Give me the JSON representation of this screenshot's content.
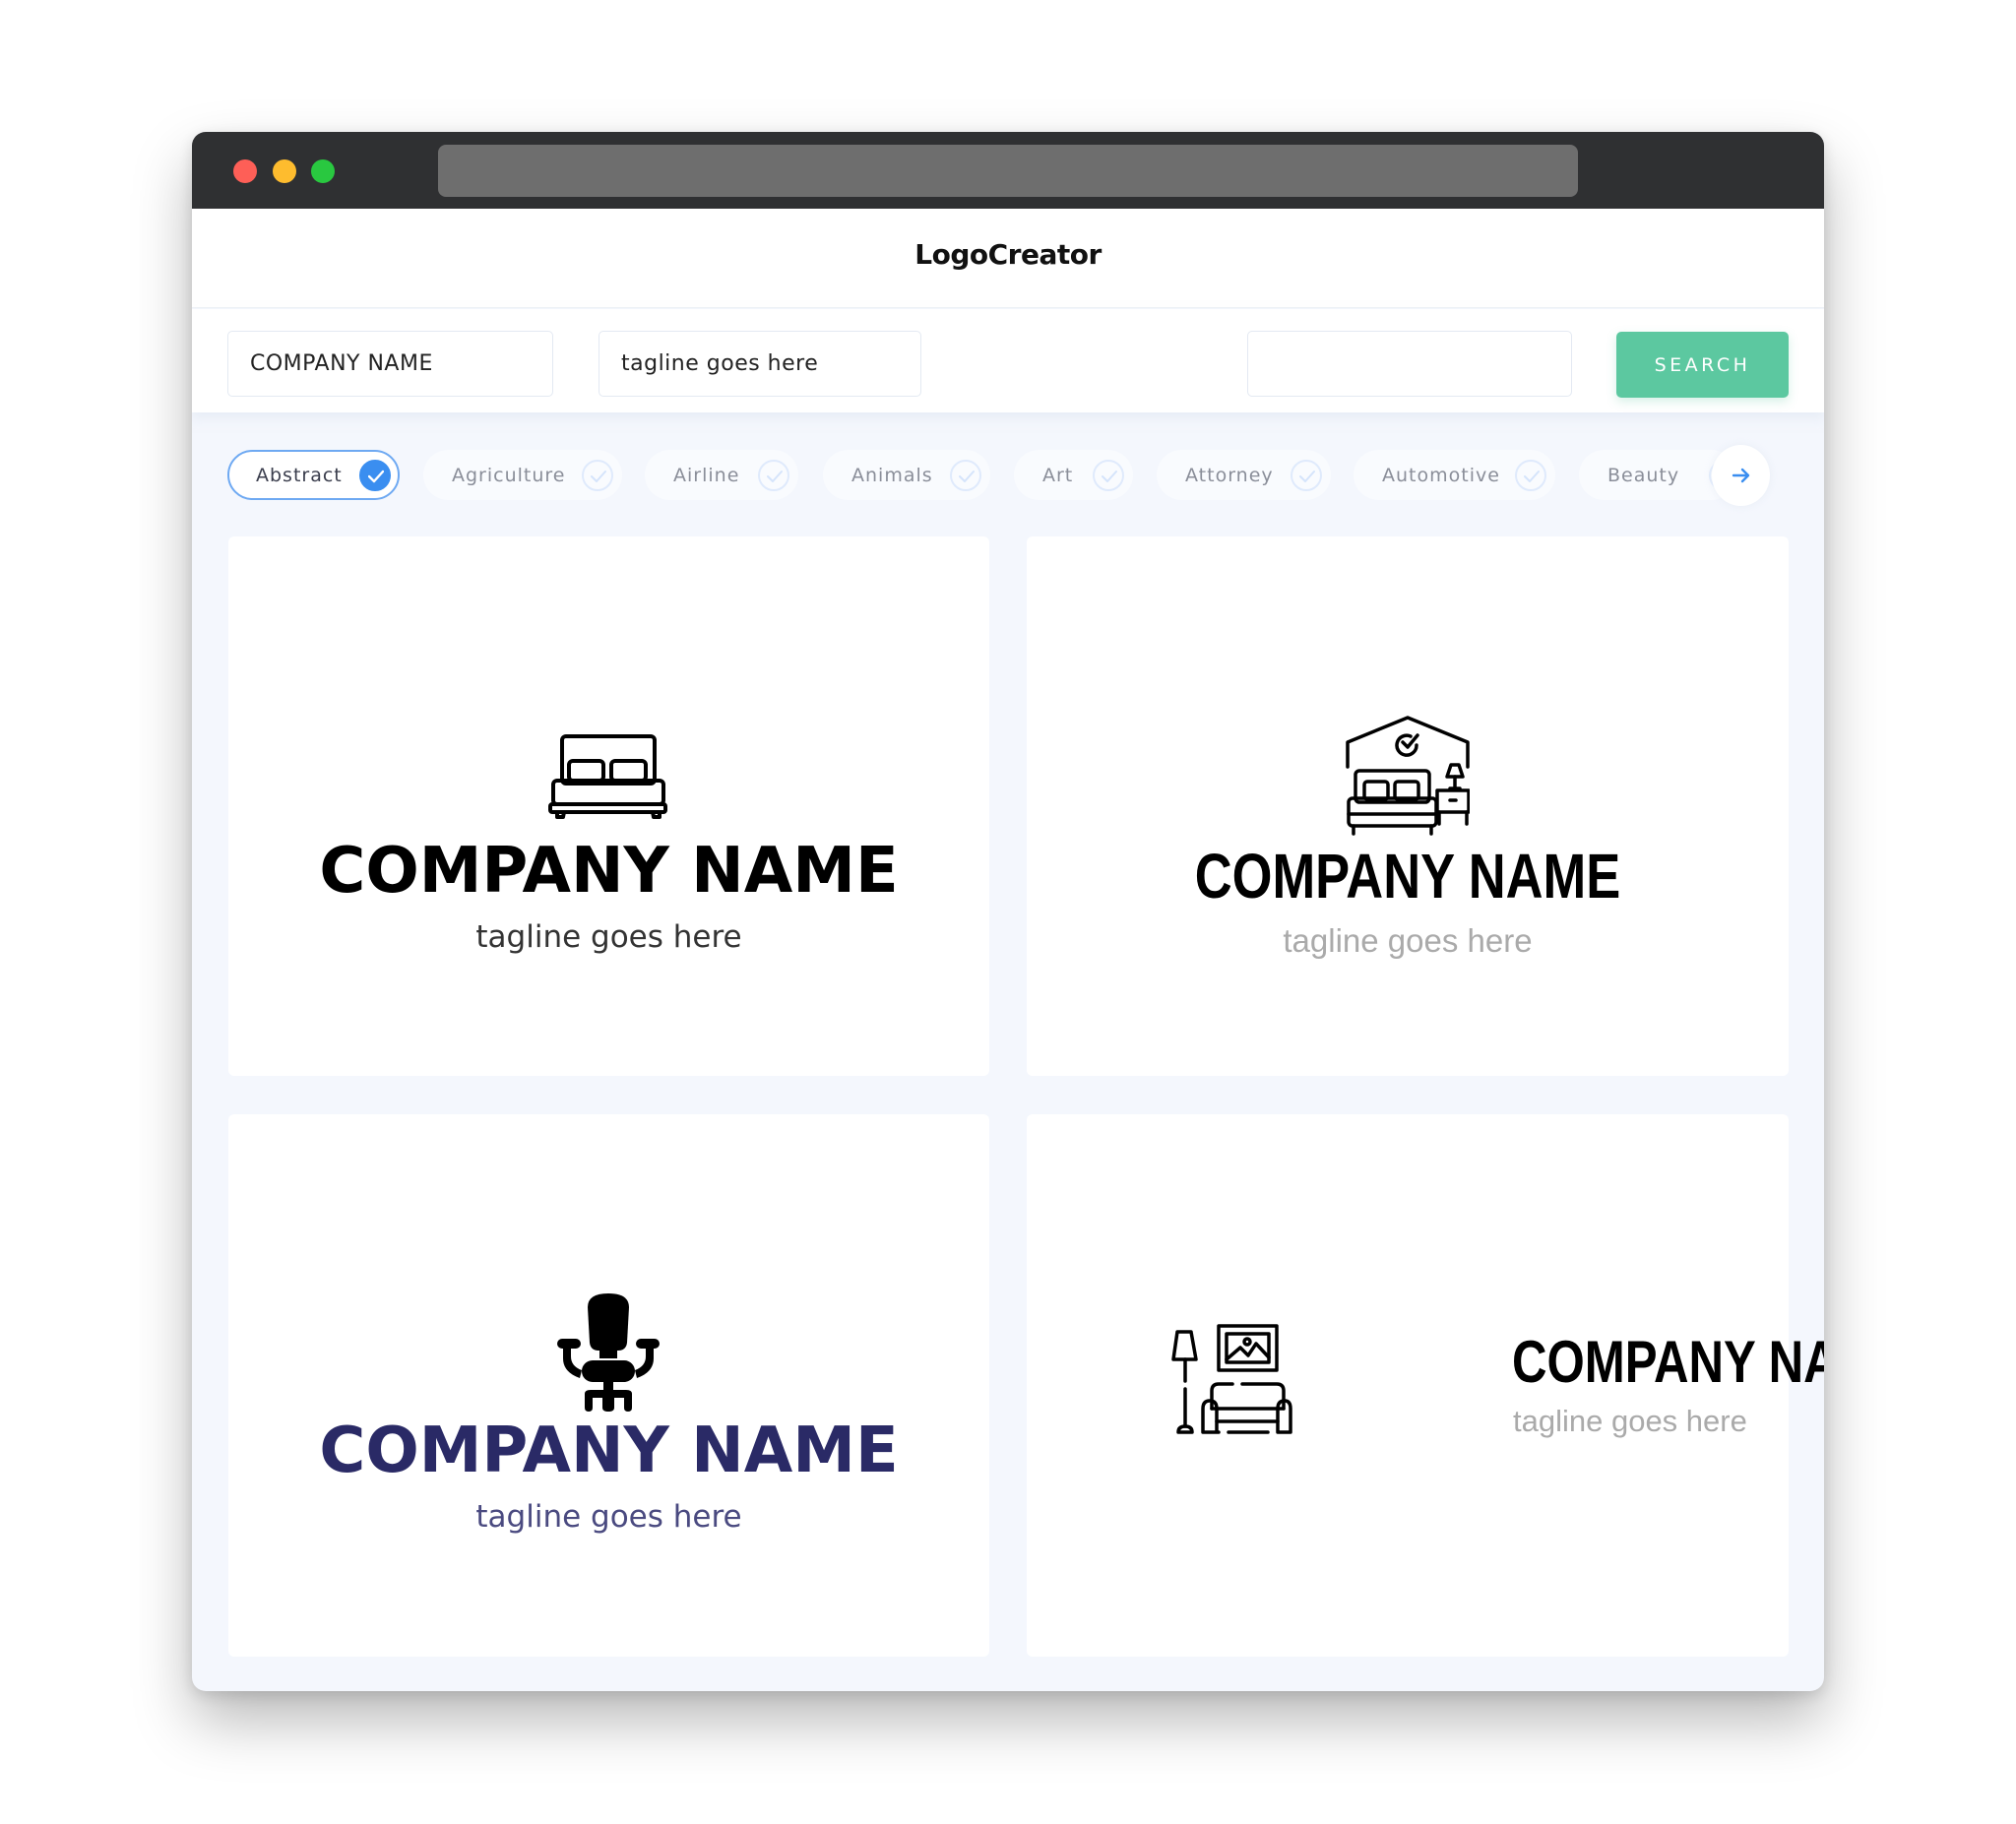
{
  "window": {
    "controls": [
      "close",
      "minimize",
      "maximize"
    ],
    "address_bar": ""
  },
  "header": {
    "title": "LogoCreator"
  },
  "search": {
    "company_name_value": "COMPANY NAME",
    "tagline_value": "tagline goes here",
    "extra_value": "",
    "search_label": "SEARCH"
  },
  "categories": {
    "items": [
      {
        "label": "Abstract",
        "selected": true
      },
      {
        "label": "Agriculture",
        "selected": false
      },
      {
        "label": "Airline",
        "selected": false
      },
      {
        "label": "Animals",
        "selected": false
      },
      {
        "label": "Art",
        "selected": false
      },
      {
        "label": "Attorney",
        "selected": false
      },
      {
        "label": "Automotive",
        "selected": false
      },
      {
        "label": "Beauty",
        "selected": false
      }
    ],
    "next_icon": "arrow-right-icon"
  },
  "colors": {
    "accent_green": "#5cc8a0",
    "accent_blue": "#3a8ef0",
    "navy": "#2a2a66",
    "titlebar": "#2f3032",
    "page_bg": "#f4f7fd"
  },
  "logos": [
    {
      "icon": "bed-icon",
      "company": "COMPANY NAME",
      "tagline": "tagline goes here",
      "layout": "stacked"
    },
    {
      "icon": "bedroom-house-icon",
      "company": "COMPANY NAME",
      "tagline": "tagline goes here",
      "layout": "stacked"
    },
    {
      "icon": "office-chair-icon",
      "company": "COMPANY NAME",
      "tagline": "tagline goes here",
      "layout": "stacked"
    },
    {
      "icon": "living-room-icon",
      "company": "COMPANY NAME",
      "tagline": "tagline goes here",
      "layout": "inline"
    }
  ]
}
